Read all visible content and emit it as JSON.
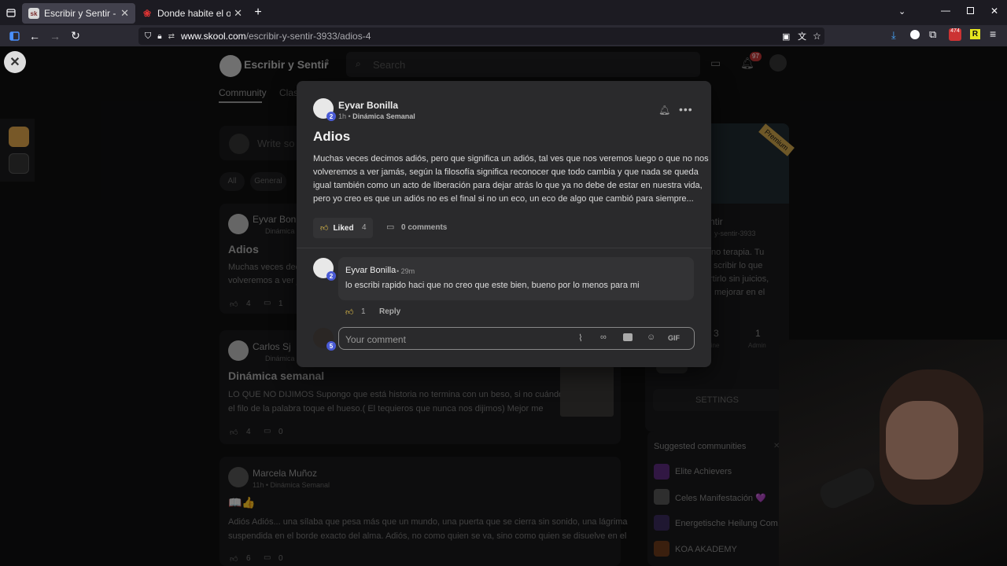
{
  "browser": {
    "tabs": [
      {
        "title": "Escribir y Sentir - Dinámica Sem",
        "favicon": "sk",
        "active": true
      },
      {
        "title": "Donde habite el olvido - Poema",
        "favicon": "rose",
        "active": false
      }
    ],
    "url_domain": "www.skool.com",
    "url_path": "/escribir-y-sentir-3933/adios-4",
    "badge_count": "474"
  },
  "site": {
    "community_name": "Escribir y Sentir",
    "search_placeholder": "Search",
    "notif_count": "97",
    "tabs": [
      "Community",
      "Clas"
    ],
    "write_placeholder": "Write so",
    "filters": [
      "All",
      "General"
    ],
    "posts": [
      {
        "author": "Eyvar Bonill",
        "meta": "Dinámica",
        "title": "Adios",
        "body1": "Muchas veces dec",
        "body2": "volveremos a ver j",
        "likes": "4",
        "comments": "1"
      },
      {
        "author": "Carlos Sj",
        "meta": "Dinámica",
        "title": "Dinámica semanal",
        "body1": "LO QUE NO DIJIMOS Supongo que está historia no termina con un beso, si no cuándo",
        "body2": "el filo de la palabra toque el hueso.( El tequieros que nunca nos dijimos) Mejor me",
        "likes": "4",
        "comments": "0"
      },
      {
        "author": "Marcela Muñoz",
        "meta": "11h • Dinámica Semanal",
        "title": "📖👍",
        "body1": "Adiós Adiós... una sílaba que pesa más que un mundo, una puerta que se cierra sin sonido, una lágrima",
        "body2": "suspendida en el borde exacto del alma. Adiós, no como quien se va, sino como quien se disuelve en el",
        "likes": "6",
        "comments": "0"
      }
    ],
    "sidebar": {
      "badge": "Premium",
      "name": "ntir",
      "slug": "y-sentir-3933",
      "desc": [
        "no terapia. Tu",
        "scribir lo que",
        "rtirlo sin juicios,",
        "mejorar en el"
      ],
      "stats": [
        {
          "value": "3",
          "label": "line"
        },
        {
          "value": "1",
          "label": "Admin"
        }
      ],
      "settings": "SETTINGS",
      "suggested_title": "Suggested communities",
      "suggested": [
        "Elite Achievers",
        "Celes Manifestación 💜",
        "Energetische Heilung Com...",
        "KOA AKADEMY"
      ]
    }
  },
  "modal": {
    "author": "Eyvar Bonilla",
    "author_level": "2",
    "time": "1h",
    "category": "Dinámica Semanal",
    "title": "Adios",
    "body": [
      "Muchas veces decimos adiós, pero que significa un adiós, tal ves que nos veremos luego o que no nos",
      "volveremos a ver jamás, según la filosofía significa reconocer que todo cambia y que nada se queda",
      "igual también como un acto de liberación para dejar atrás lo que ya no debe de estar en nuestra vida,",
      "pero yo creo es que un adiós no es el final si no un eco, un eco de algo que cambió para siempre..."
    ],
    "liked_label": "Liked",
    "like_count": "4",
    "comments_label": "0 comments",
    "comment": {
      "author": "Eyvar Bonilla",
      "level": "2",
      "time": "• 29m",
      "text": "lo escribi rapido haci que no creo que este bien, bueno por lo menos para mi",
      "likes": "1",
      "reply": "Reply"
    },
    "input": {
      "placeholder": "Your comment",
      "user_level": "5",
      "gif": "GIF"
    }
  }
}
